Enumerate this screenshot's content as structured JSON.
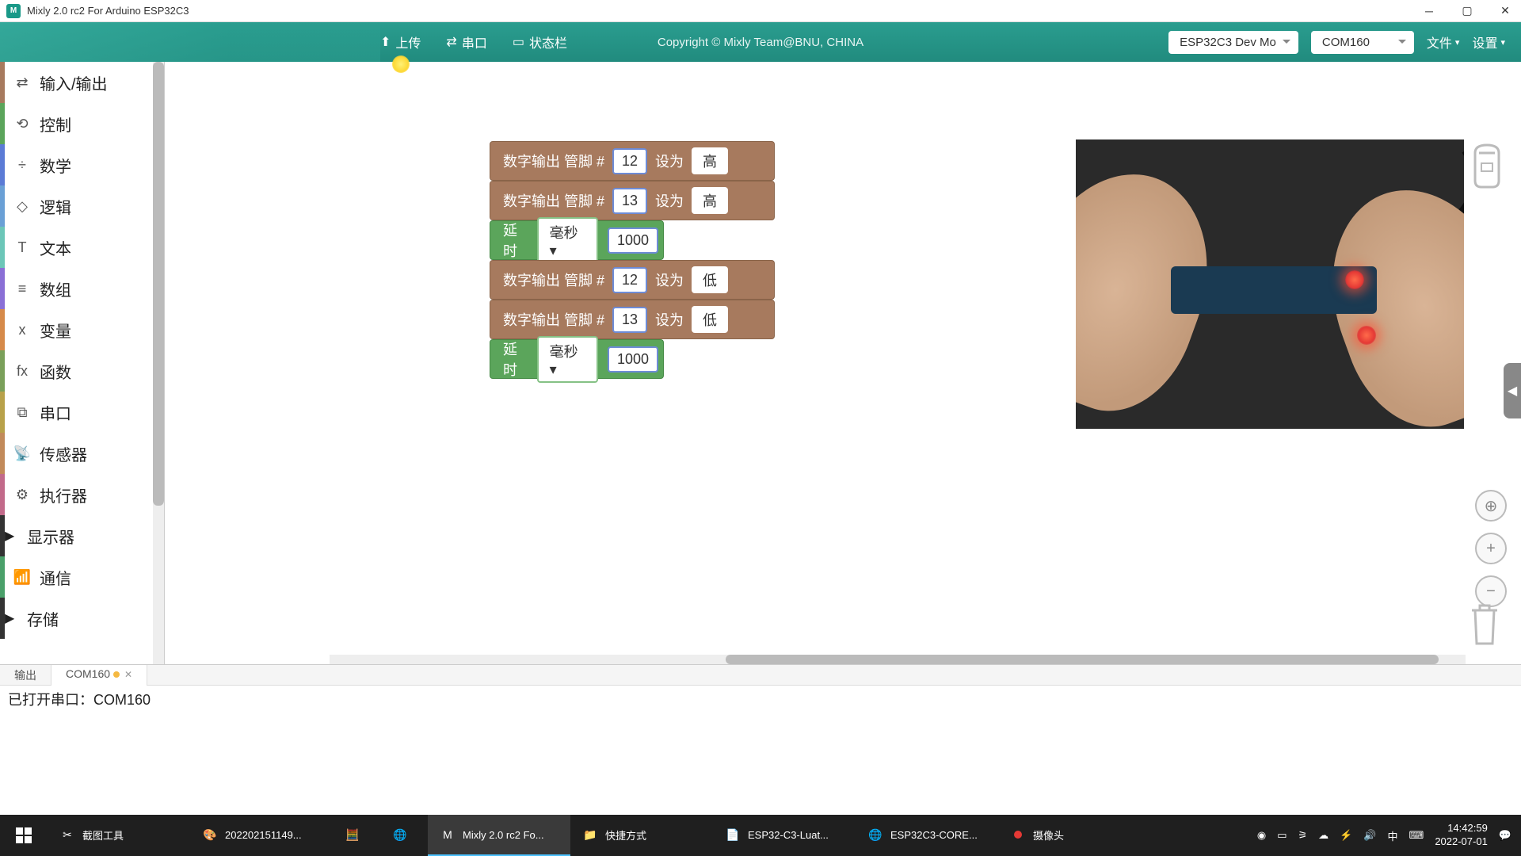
{
  "window": {
    "title": "Mixly 2.0 rc2 For Arduino ESP32C3"
  },
  "toolbar": {
    "upload": "上传",
    "serial": "串口",
    "status_bar": "状态栏",
    "copyright": "Copyright © Mixly Team@BNU, CHINA",
    "board": "ESP32C3 Dev Mo",
    "port": "COM160",
    "file": "文件",
    "settings": "设置"
  },
  "categories": [
    {
      "label": "输入/输出",
      "color": "#a77a5e",
      "arrow": false
    },
    {
      "label": "控制",
      "color": "#5ba55b",
      "arrow": false
    },
    {
      "label": "数学",
      "color": "#5b7bd6",
      "arrow": false
    },
    {
      "label": "逻辑",
      "color": "#6aa0d6",
      "arrow": false
    },
    {
      "label": "文本",
      "color": "#6cc6b8",
      "arrow": false
    },
    {
      "label": "数组",
      "color": "#8a6fd6",
      "arrow": false
    },
    {
      "label": "变量",
      "color": "#d68a4a",
      "arrow": false
    },
    {
      "label": "函数",
      "color": "#7aa05a",
      "arrow": false
    },
    {
      "label": "串口",
      "color": "#b8a14a",
      "arrow": false
    },
    {
      "label": "传感器",
      "color": "#c28a5a",
      "arrow": false
    },
    {
      "label": "执行器",
      "color": "#c26a8a",
      "arrow": false
    },
    {
      "label": "显示器",
      "color": "#333333",
      "arrow": true
    },
    {
      "label": "通信",
      "color": "#4aa06a",
      "arrow": false
    },
    {
      "label": "存储",
      "color": "#333333",
      "arrow": true
    }
  ],
  "blocks": [
    {
      "type": "digital",
      "prefix": "数字输出 管脚 #",
      "pin": "12",
      "mid": "设为",
      "val": "高"
    },
    {
      "type": "digital",
      "prefix": "数字输出 管脚 #",
      "pin": "13",
      "mid": "设为",
      "val": "高"
    },
    {
      "type": "delay",
      "prefix": "延时",
      "unit": "毫秒",
      "val": "1000"
    },
    {
      "type": "digital",
      "prefix": "数字输出 管脚 #",
      "pin": "12",
      "mid": "设为",
      "val": "低"
    },
    {
      "type": "digital",
      "prefix": "数字输出 管脚 #",
      "pin": "13",
      "mid": "设为",
      "val": "低"
    },
    {
      "type": "delay",
      "prefix": "延时",
      "unit": "毫秒",
      "val": "1000"
    }
  ],
  "console": {
    "tabs": [
      {
        "label": "输出",
        "active": false
      },
      {
        "label": "COM160",
        "active": true,
        "dirty": true
      }
    ],
    "line1": "已打开串口：COM160"
  },
  "taskbar": {
    "items": [
      {
        "label": "截图工具",
        "icon": "✂",
        "active": false
      },
      {
        "label": "202202151149...",
        "icon": "🎨",
        "active": false
      },
      {
        "label": "",
        "icon": "🧮",
        "active": false,
        "narrow": true
      },
      {
        "label": "",
        "icon": "🌐",
        "active": false,
        "narrow": true
      },
      {
        "label": "Mixly 2.0 rc2 Fo...",
        "icon": "M",
        "active": true
      },
      {
        "label": "快捷方式",
        "icon": "📁",
        "active": false
      },
      {
        "label": "ESP32-C3-Luat...",
        "icon": "📄",
        "active": false
      },
      {
        "label": "ESP32C3-CORE...",
        "icon": "🌐",
        "active": false
      },
      {
        "label": "摄像头",
        "icon": "●",
        "active": false,
        "rec": true
      }
    ],
    "ime": "中",
    "time": "14:42:59",
    "date": "2022-07-01"
  }
}
